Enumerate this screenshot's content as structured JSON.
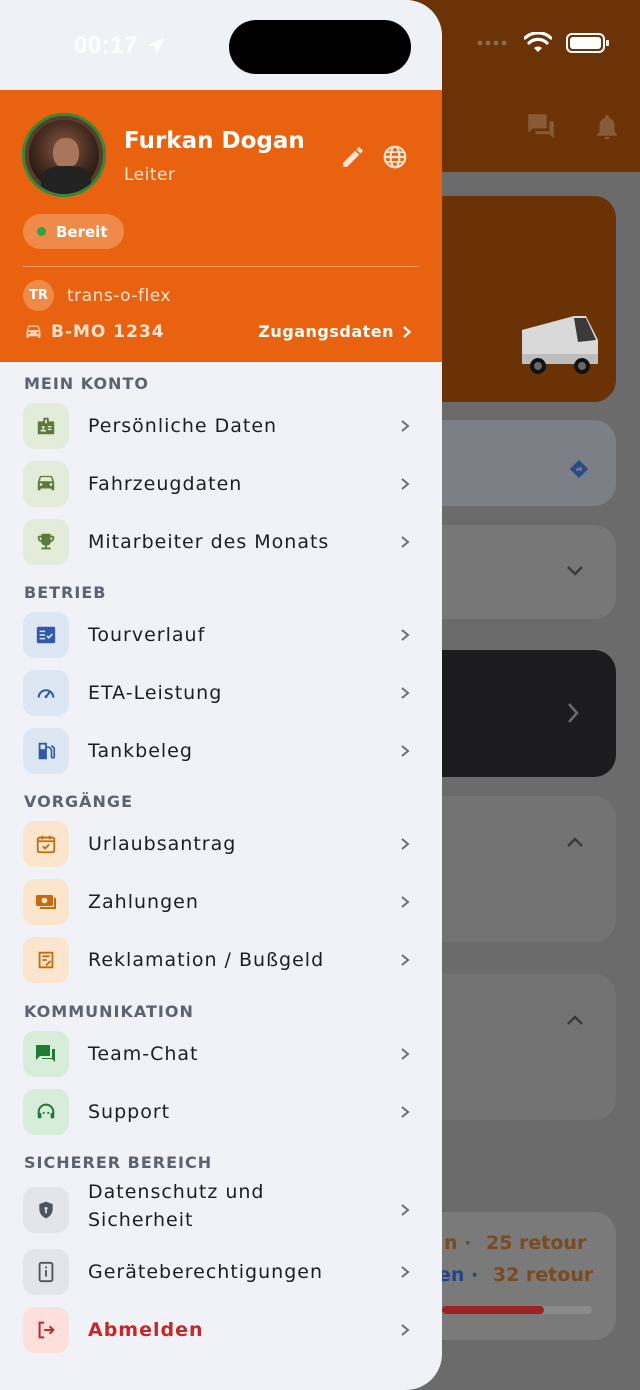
{
  "status_bar": {
    "time": "00:17"
  },
  "profile": {
    "name": "Furkan Dogan",
    "role": "Leiter",
    "status_badge": "Bereit",
    "org_initials": "TR",
    "org_name": "trans-o-flex",
    "plate": "B-MO 1234",
    "access_label": "Zugangsdaten"
  },
  "sections": {
    "account": {
      "title": "MEIN KONTO",
      "items": [
        "Persönliche Daten",
        "Fahrzeugdaten",
        "Mitarbeiter des Monats"
      ]
    },
    "operations": {
      "title": "BETRIEB",
      "items": [
        "Tourverlauf",
        "ETA-Leistung",
        "Tankbeleg"
      ]
    },
    "processes": {
      "title": "VORGÄNGE",
      "items": [
        "Urlaubsantrag",
        "Zahlungen",
        "Reklamation / Bußgeld"
      ]
    },
    "communication": {
      "title": "KOMMUNIKATION",
      "items": [
        "Team-Chat",
        "Support"
      ]
    },
    "secure": {
      "title": "SICHERER BEREICH",
      "items": [
        "Datenschutz und",
        "Sicherheit",
        "Geräteberechtigungen"
      ]
    }
  },
  "logout_label": "Abmelden",
  "background": {
    "retour_1": "25 retour",
    "retour_2": "32 retour",
    "fragment_1": "n  ·",
    "fragment_2": "en  ·"
  },
  "colors": {
    "brand_orange": "#e8620f",
    "status_green": "#27a844",
    "logout_red": "#c62828"
  }
}
